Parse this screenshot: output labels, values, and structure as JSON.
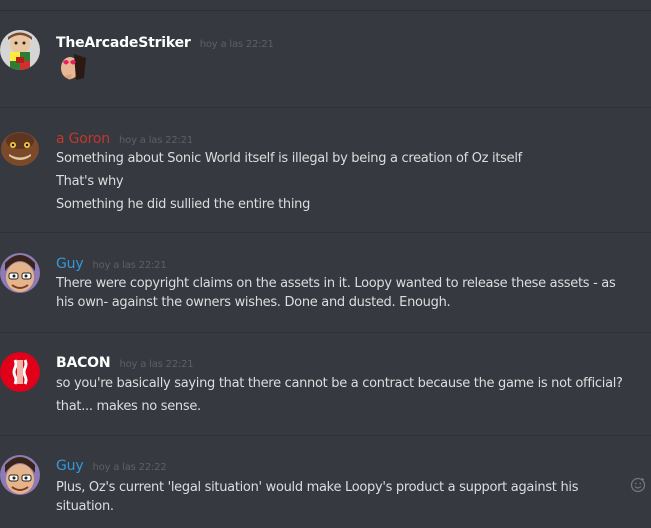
{
  "messages": [
    {
      "username": "TheArcadeStriker",
      "username_color": "#ffffff",
      "timestamp": "hoy a las 22:21",
      "avatar_icon": "arcade-striker-avatar",
      "lines": [],
      "attachment": "face-with-heart-eyes-emoji"
    },
    {
      "username": "a Goron",
      "username_color": "#c0392b",
      "timestamp": "hoy a las 22:21",
      "avatar_icon": "goron-avatar",
      "lines": [
        "Something about Sonic World itself is illegal by being a creation of Oz itself",
        "That's why",
        "Something he did sullied the entire thing"
      ]
    },
    {
      "username": "Guy",
      "username_color": "#3498db",
      "timestamp": "hoy a las 22:21",
      "avatar_icon": "guy-avatar",
      "lines": [
        "There were copyright claims on the assets in it. Loopy wanted to release these assets - as",
        "his own- against the owners wishes. Done and dusted. Enough."
      ]
    },
    {
      "username": "BACON",
      "username_color": "#ffffff",
      "timestamp": "hoy a las 22:21",
      "avatar_icon": "bacon-avatar",
      "lines": [
        "so you're basically saying that there cannot be a contract because the game is not official?",
        "that... makes no sense."
      ]
    },
    {
      "username": "Guy",
      "username_color": "#3498db",
      "timestamp": "hoy a las 22:22",
      "avatar_icon": "guy-avatar",
      "lines": [
        "Plus, Oz's current 'legal situation' would make Loopy's product a support against his",
        "situation."
      ]
    }
  ],
  "icons": {
    "add_reaction": "smiley-reaction-icon"
  }
}
